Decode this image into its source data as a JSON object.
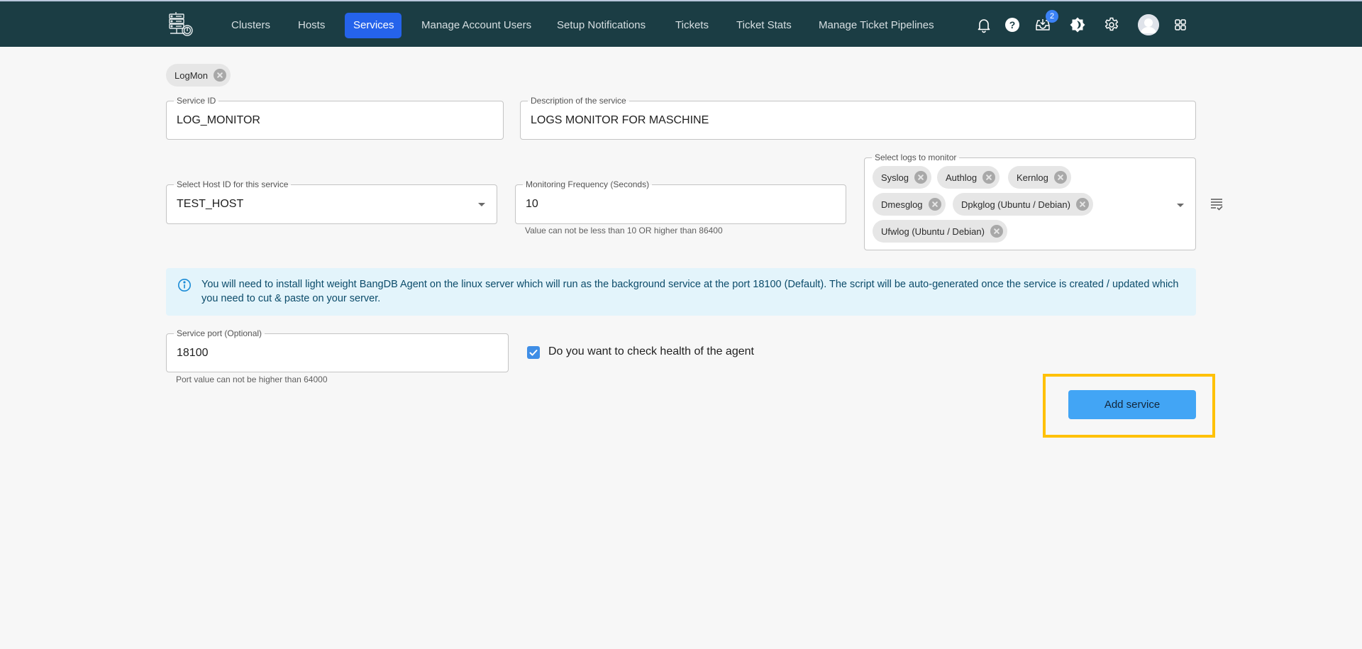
{
  "nav": {
    "items": [
      {
        "label": "Clusters",
        "active": false
      },
      {
        "label": "Hosts",
        "active": false
      },
      {
        "label": "Services",
        "active": true
      },
      {
        "label": "Manage Account Users",
        "active": false
      },
      {
        "label": "Setup Notifications",
        "active": false
      },
      {
        "label": "Tickets",
        "active": false
      },
      {
        "label": "Ticket Stats",
        "active": false
      },
      {
        "label": "Manage Ticket Pipelines",
        "active": false
      }
    ],
    "icons": [
      "bell-icon",
      "help-icon",
      "inbox-download-icon",
      "theme-toggle-icon",
      "settings-gear-icon",
      "avatar",
      "apps-grid-icon"
    ],
    "inbox_badge": "2"
  },
  "service_tag": {
    "label": "LogMon"
  },
  "form": {
    "service_id": {
      "label": "Service ID",
      "value": "LOG_MONITOR"
    },
    "description": {
      "label": "Description of the service",
      "value": "LOGS MONITOR FOR MASCHINE"
    },
    "host_id": {
      "label": "Select Host ID for this service",
      "value": "TEST_HOST"
    },
    "frequency": {
      "label": "Monitoring Frequency (Seconds)",
      "value": "10",
      "helper": "Value can not be less than 10 OR higher than 86400"
    },
    "logs": {
      "label": "Select logs to monitor",
      "selected": [
        "Syslog",
        "Authlog",
        "Kernlog",
        "Dmesglog",
        "Dpkglog (Ubuntu / Debian)",
        "Ufwlog (Ubuntu / Debian)"
      ]
    },
    "info": "You will need to install light weight BangDB Agent on the linux server which will run as the background service at the port 18100 (Default). The script will be auto-generated once the service is created / updated which you need to cut & paste on your server.",
    "port": {
      "label": "Service port (Optional)",
      "value": "18100",
      "helper": "Port value can not be higher than 64000"
    },
    "health_check": {
      "label": "Do you want to check health of the agent",
      "checked": true
    },
    "submit_label": "Add service"
  },
  "colors": {
    "navbar": "#1b3d44",
    "active_nav": "#2563eb",
    "primary_button": "#42a5f5",
    "highlight": "#ffc107",
    "info_bg": "#e3f4fb"
  }
}
